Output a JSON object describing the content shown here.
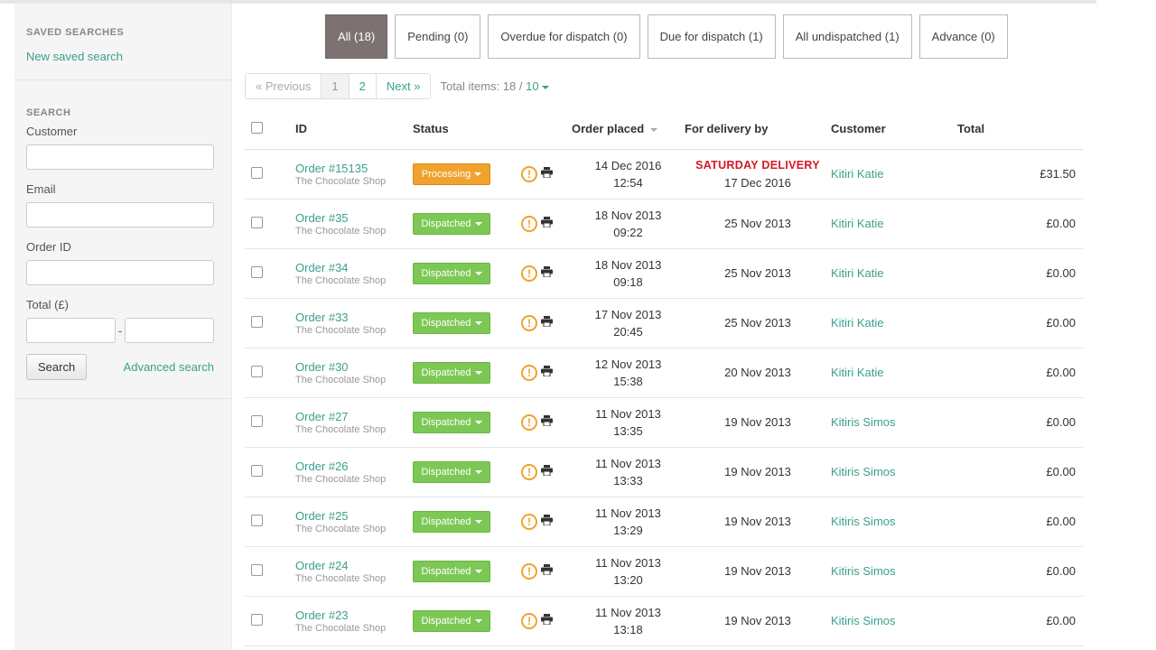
{
  "sidebar": {
    "saved_searches_heading": "SAVED SEARCHES",
    "new_saved_search": "New saved search",
    "search_heading": "SEARCH",
    "customer_label": "Customer",
    "email_label": "Email",
    "order_id_label": "Order ID",
    "total_label": "Total (£)",
    "range_separator": "-",
    "search_button": "Search",
    "advanced_search": "Advanced search"
  },
  "tabs": [
    {
      "label": "All (18)",
      "active": true
    },
    {
      "label": "Pending (0)"
    },
    {
      "label": "Overdue for dispatch (0)"
    },
    {
      "label": "Due for dispatch (1)"
    },
    {
      "label": "All undispatched (1)"
    },
    {
      "label": "Advance (0)"
    }
  ],
  "pager": {
    "previous": "« Previous",
    "page1": "1",
    "page2": "2",
    "next": "Next »",
    "total_items": "Total items: 18 / ",
    "per_page": "10"
  },
  "table": {
    "headers": {
      "id": "ID",
      "status": "Status",
      "order_placed": "Order placed",
      "delivery": "For delivery by",
      "customer": "Customer",
      "total": "Total"
    },
    "rows": [
      {
        "order": "Order #15135",
        "shop": "The Chocolate Shop",
        "status": "Processing",
        "placed_date": "14 Dec 2016",
        "placed_time": "12:54",
        "delivery_flag": "SATURDAY DELIVERY",
        "delivery": "17 Dec 2016",
        "customer": "Kitiri Katie",
        "total": "£31.50"
      },
      {
        "order": "Order #35",
        "shop": "The Chocolate Shop",
        "status": "Dispatched",
        "placed_date": "18 Nov 2013",
        "placed_time": "09:22",
        "delivery_flag": "",
        "delivery": "25 Nov 2013",
        "customer": "Kitiri Katie",
        "total": "£0.00"
      },
      {
        "order": "Order #34",
        "shop": "The Chocolate Shop",
        "status": "Dispatched",
        "placed_date": "18 Nov 2013",
        "placed_time": "09:18",
        "delivery_flag": "",
        "delivery": "25 Nov 2013",
        "customer": "Kitiri Katie",
        "total": "£0.00"
      },
      {
        "order": "Order #33",
        "shop": "The Chocolate Shop",
        "status": "Dispatched",
        "placed_date": "17 Nov 2013",
        "placed_time": "20:45",
        "delivery_flag": "",
        "delivery": "25 Nov 2013",
        "customer": "Kitiri Katie",
        "total": "£0.00"
      },
      {
        "order": "Order #30",
        "shop": "The Chocolate Shop",
        "status": "Dispatched",
        "placed_date": "12 Nov 2013",
        "placed_time": "15:38",
        "delivery_flag": "",
        "delivery": "20 Nov 2013",
        "customer": "Kitiri Katie",
        "total": "£0.00"
      },
      {
        "order": "Order #27",
        "shop": "The Chocolate Shop",
        "status": "Dispatched",
        "placed_date": "11 Nov 2013",
        "placed_time": "13:35",
        "delivery_flag": "",
        "delivery": "19 Nov 2013",
        "customer": "Kitiris Simos",
        "total": "£0.00"
      },
      {
        "order": "Order #26",
        "shop": "The Chocolate Shop",
        "status": "Dispatched",
        "placed_date": "11 Nov 2013",
        "placed_time": "13:33",
        "delivery_flag": "",
        "delivery": "19 Nov 2013",
        "customer": "Kitiris Simos",
        "total": "£0.00"
      },
      {
        "order": "Order #25",
        "shop": "The Chocolate Shop",
        "status": "Dispatched",
        "placed_date": "11 Nov 2013",
        "placed_time": "13:29",
        "delivery_flag": "",
        "delivery": "19 Nov 2013",
        "customer": "Kitiris Simos",
        "total": "£0.00"
      },
      {
        "order": "Order #24",
        "shop": "The Chocolate Shop",
        "status": "Dispatched",
        "placed_date": "11 Nov 2013",
        "placed_time": "13:20",
        "delivery_flag": "",
        "delivery": "19 Nov 2013",
        "customer": "Kitiris Simos",
        "total": "£0.00"
      },
      {
        "order": "Order #23",
        "shop": "The Chocolate Shop",
        "status": "Dispatched",
        "placed_date": "11 Nov 2013",
        "placed_time": "13:18",
        "delivery_flag": "",
        "delivery": "19 Nov 2013",
        "customer": "Kitiris Simos",
        "total": "£0.00"
      }
    ]
  },
  "icons": {
    "warning": "warning-icon",
    "print": "printer-icon",
    "warning_glyph": "!"
  },
  "colors": {
    "accent": "#3aa08c",
    "active_tab": "#7d7272",
    "processing": "#f0a22d",
    "dispatched": "#7dc855",
    "saturday_delivery": "#d71920"
  }
}
